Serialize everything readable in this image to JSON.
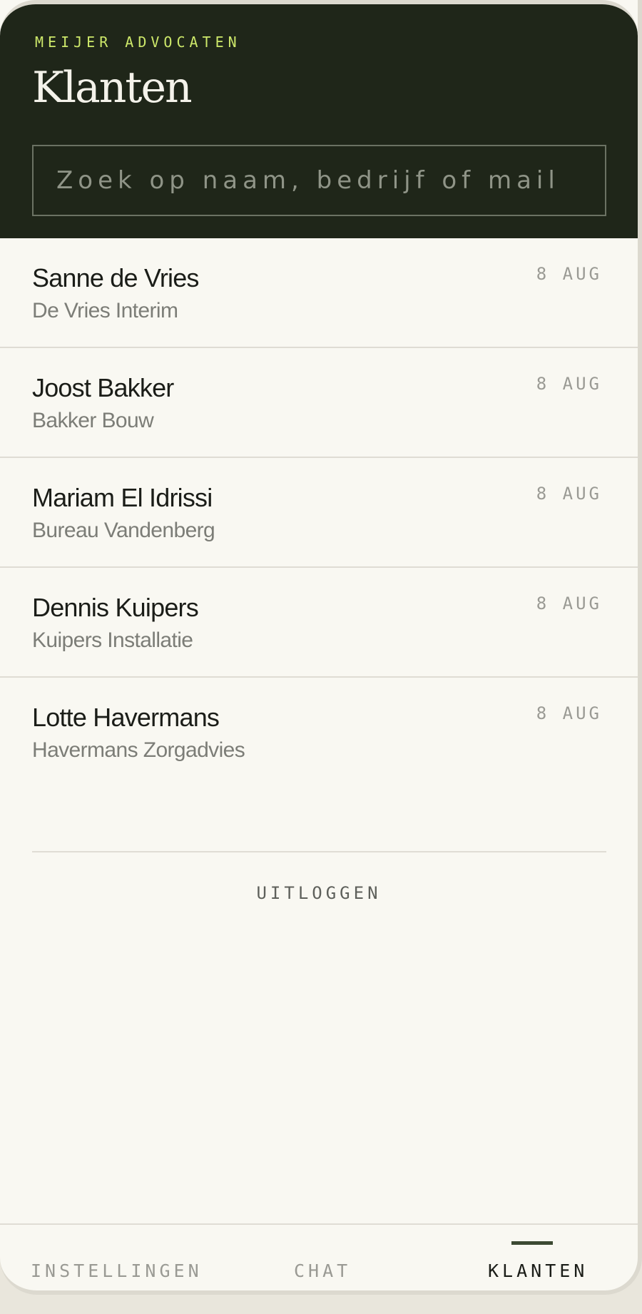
{
  "header": {
    "firm_name": "MEIJER ADVOCATEN",
    "title": "Klanten"
  },
  "search": {
    "placeholder": "Zoek op naam, bedrijf of mail",
    "value": ""
  },
  "clients": [
    {
      "name": "Sanne de Vries",
      "company": "De Vries Interim",
      "date": "8 AUG"
    },
    {
      "name": "Joost Bakker",
      "company": "Bakker Bouw",
      "date": "8 AUG"
    },
    {
      "name": "Mariam El Idrissi",
      "company": "Bureau Vandenberg",
      "date": "8 AUG"
    },
    {
      "name": "Dennis Kuipers",
      "company": "Kuipers Installatie",
      "date": "8 AUG"
    },
    {
      "name": "Lotte Havermans",
      "company": "Havermans Zorgadvies",
      "date": "8 AUG"
    }
  ],
  "logout_label": "UITLOGGEN",
  "nav": {
    "items": [
      {
        "label": "INSTELLINGEN",
        "active": false
      },
      {
        "label": "CHAT",
        "active": false
      },
      {
        "label": "KLANTEN",
        "active": true
      }
    ]
  },
  "colors": {
    "header_bg": "#1f2619",
    "accent": "#cde86a",
    "background": "#f9f8f2",
    "active_indicator": "#3c4a33"
  }
}
